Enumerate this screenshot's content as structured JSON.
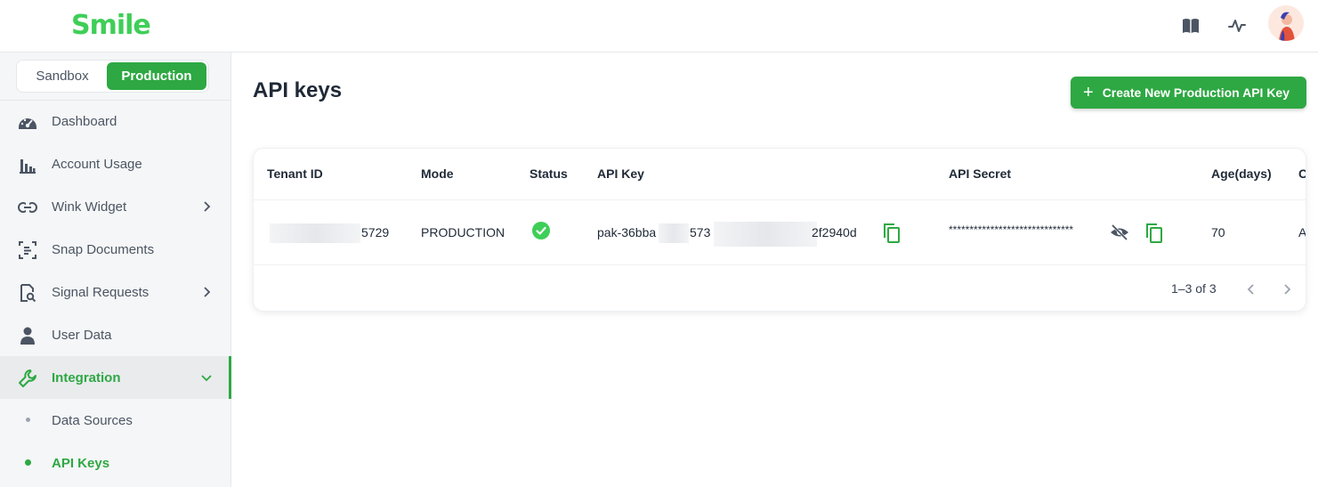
{
  "app": {
    "logo_text": "Smile",
    "brand_color": "#2ea843",
    "logo_color": "#3fce58"
  },
  "header": {
    "icons": [
      "book-icon",
      "activity-icon",
      "avatar"
    ]
  },
  "mode_toggle": {
    "sandbox_label": "Sandbox",
    "production_label": "Production",
    "selected": "Production"
  },
  "sidebar": {
    "items": [
      {
        "label": "Dashboard",
        "icon": "dashboard-icon"
      },
      {
        "label": "Account Usage",
        "icon": "bar-chart-icon"
      },
      {
        "label": "Wink Widget",
        "icon": "link-icon",
        "has_chevron": true
      },
      {
        "label": "Snap Documents",
        "icon": "scan-document-icon"
      },
      {
        "label": "Signal Requests",
        "icon": "search-document-icon",
        "has_chevron": true
      },
      {
        "label": "User Data",
        "icon": "person-icon"
      },
      {
        "label": "Integration",
        "icon": "wrench-icon",
        "expanded": true,
        "active": true
      },
      {
        "label": "Data Sources",
        "sub": true
      },
      {
        "label": "API Keys",
        "sub": true,
        "active": true
      }
    ]
  },
  "main": {
    "title": "API keys",
    "create_button_label": "Create New Production API Key",
    "table": {
      "columns": [
        "Tenant ID",
        "Mode",
        "Status",
        "API Key",
        "API Secret",
        "Age(days)",
        "C"
      ],
      "rows": [
        {
          "tenant_id_suffix": "5729",
          "mode": "PRODUCTION",
          "status": "active",
          "api_key_prefix": "pak-36bba",
          "api_key_mid": "573",
          "api_key_suffix": "2f2940d",
          "api_secret": "******************************",
          "age_days": "70",
          "last_col": "A"
        }
      ],
      "pagination": "1–3 of 3"
    }
  }
}
